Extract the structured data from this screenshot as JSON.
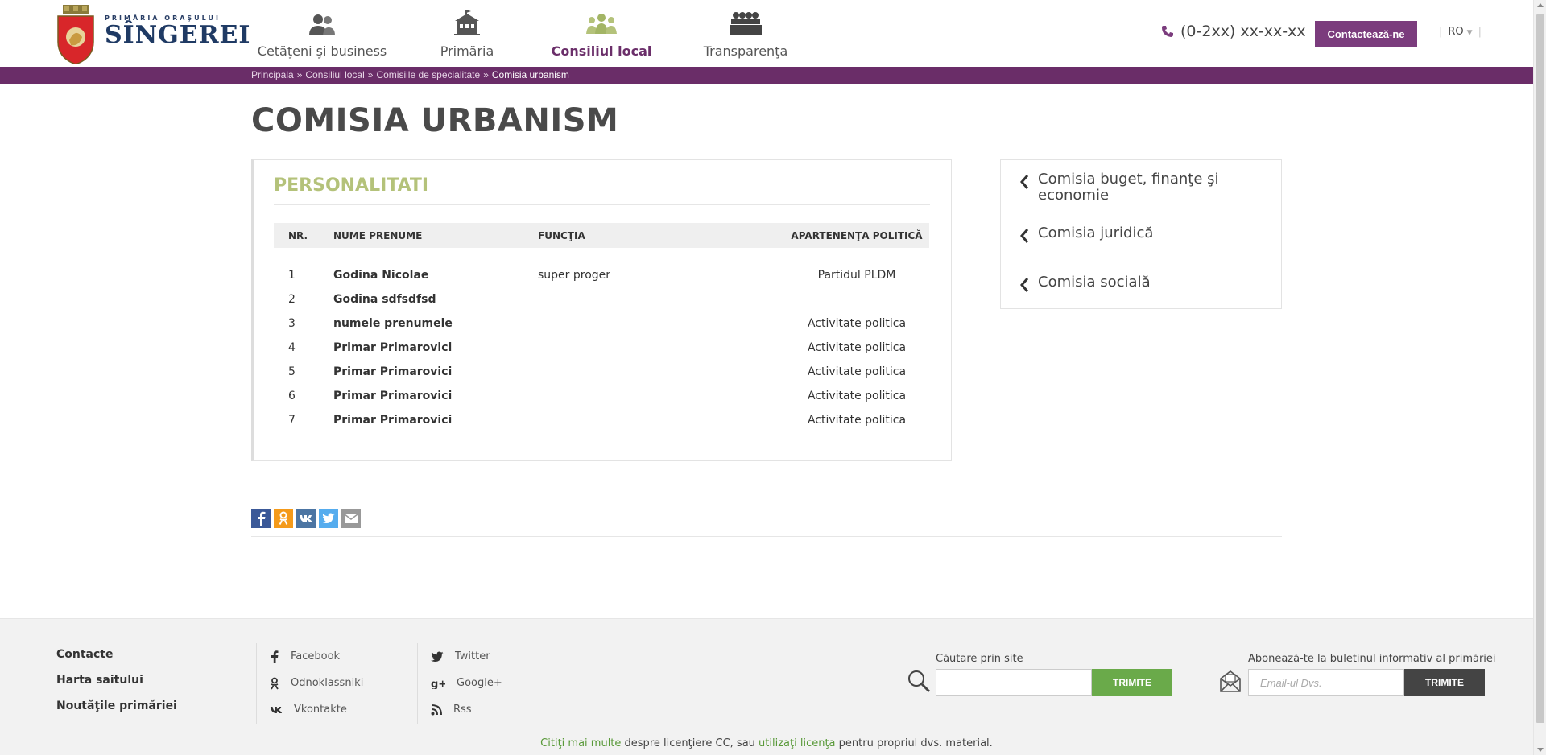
{
  "header": {
    "logo_subtitle": "PRIMĂRIA ORAŞULUI",
    "logo_title": "SÎNGEREI",
    "nav": [
      {
        "label": "Cetăţeni şi business",
        "icon": "people-icon"
      },
      {
        "label": "Primăria",
        "icon": "building-icon"
      },
      {
        "label": "Consiliul local",
        "icon": "council-icon",
        "active": true
      },
      {
        "label": "Transparenţa",
        "icon": "meeting-icon"
      }
    ],
    "phone": "(0-2xx) xx-xx-xx",
    "contact_button": "Contactează-ne",
    "language": "RO"
  },
  "breadcrumb": {
    "items": [
      "Principala",
      "Consiliul local",
      "Comisiile de specialitate"
    ],
    "separator": "»",
    "current": "Comisia urbanism"
  },
  "page_title": "COMISIA URBANISM",
  "section": {
    "title": "PERSONALITATI",
    "columns": [
      "NR.",
      "NUME PRENUME",
      "FUNCŢIA",
      "APARTENENŢA POLITICĂ"
    ],
    "rows": [
      {
        "nr": "1",
        "name": "Godina Nicolae",
        "func": "super proger",
        "party": "Partidul PLDM"
      },
      {
        "nr": "2",
        "name": "Godina sdfsdfsd",
        "func": "",
        "party": ""
      },
      {
        "nr": "3",
        "name": "numele prenumele",
        "func": "",
        "party": "Activitate politica"
      },
      {
        "nr": "4",
        "name": "Primar Primarovici",
        "func": "",
        "party": "Activitate politica"
      },
      {
        "nr": "5",
        "name": "Primar Primarovici",
        "func": "",
        "party": "Activitate politica"
      },
      {
        "nr": "6",
        "name": "Primar Primarovici",
        "func": "",
        "party": "Activitate politica"
      },
      {
        "nr": "7",
        "name": "Primar Primarovici",
        "func": "",
        "party": "Activitate politica"
      }
    ]
  },
  "sidebar": {
    "items": [
      {
        "label": "Comisia buget, finanţe şi economie"
      },
      {
        "label": "Comisia juridică"
      },
      {
        "label": "Comisia socială"
      }
    ]
  },
  "share": {
    "icons": [
      "facebook-icon",
      "odnoklassniki-icon",
      "vkontakte-icon",
      "twitter-icon",
      "email-icon"
    ],
    "colors": {
      "facebook": "#3b5998",
      "odnoklassniki": "#f49a1a",
      "vkontakte": "#4c75a3",
      "twitter": "#55acee",
      "email": "#999999"
    }
  },
  "footer": {
    "links": [
      "Contacte",
      "Harta saitului",
      "Noutăţile primăriei"
    ],
    "social_col1": [
      "Facebook",
      "Odnoklassniki",
      "Vkontakte"
    ],
    "social_col2": [
      "Twitter",
      "Google+",
      "Rss"
    ],
    "search_label": "Căutare prin site",
    "search_placeholder": "",
    "search_button": "TRIMITE",
    "newsletter_label": "Abonează-te la buletinul informativ al primăriei",
    "newsletter_placeholder": "Email-ul Dvs.",
    "newsletter_button": "TRIMITE",
    "license_link1": "Citiţi mai multe",
    "license_text1": " despre licenţiere CC, sau ",
    "license_link2": "utilizaţi licenţa",
    "license_text2": " pentru propriul dvs. material."
  },
  "colors": {
    "brand_purple": "#6a2d68",
    "button_purple": "#7b3c7d",
    "accent_green": "#b4c27a",
    "search_button_green": "#6aaa4a"
  }
}
